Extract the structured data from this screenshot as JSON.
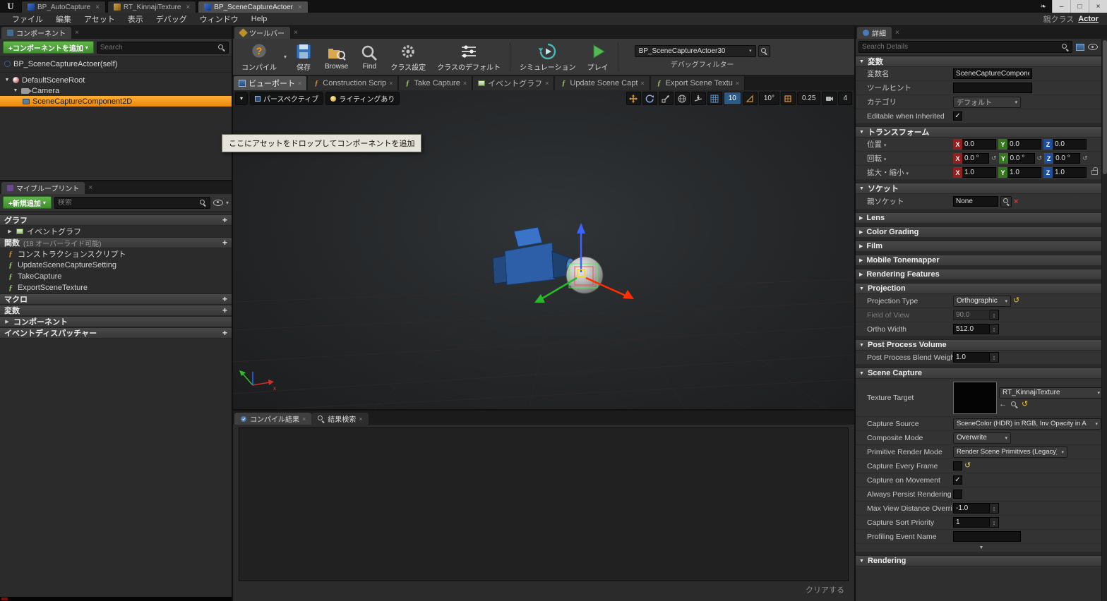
{
  "colors": {
    "selection_orange": "#E8890C",
    "add_button_green": "#3F8F2F",
    "axis_x": "#8F2121",
    "axis_y": "#35761F",
    "axis_z": "#1F4E9C",
    "reset_yellow": "#E2C23C"
  },
  "window": {
    "logo": "U",
    "tabs": [
      "BP_AutoCapture",
      "RT_KinnajiTexture",
      "BP_SceneCaptureActoer"
    ],
    "menus": [
      "ファイル",
      "編集",
      "アセット",
      "表示",
      "デバッグ",
      "ウィンドウ",
      "Help"
    ],
    "parent_class_label": "親クラス",
    "parent_class_value": "Actor",
    "minimize": "–",
    "maximize": "□",
    "close": "×"
  },
  "components": {
    "tab": "コンポーネント",
    "add_button": "+コンポーネントを追加",
    "search_placeholder": "Search",
    "items": [
      "BP_SceneCaptureActoer(self)",
      "DefaultSceneRoot",
      "Camera",
      "SceneCaptureComponent2D"
    ]
  },
  "my_blueprint": {
    "tab": "マイブループリント",
    "add_button": "+新規追加",
    "search_placeholder": "検索",
    "sections": {
      "graph": "グラフ",
      "event_graph": "イベントグラフ",
      "functions": "関数",
      "functions_note": "(18 オーバーライド可能)",
      "macro": "マクロ",
      "variables": "変数",
      "components": "コンポーネント",
      "dispatchers": "イベントディスパッチャー"
    },
    "functions": [
      "コンストラクションスクリプト",
      "UpdateSceneCaptureSetting",
      "TakeCapture",
      "ExportSceneTexture"
    ]
  },
  "toolbar": {
    "tab": "ツールバー",
    "compile": "コンパイル",
    "save": "保存",
    "browse": "Browse",
    "find": "Find",
    "class_settings": "クラス設定",
    "class_defaults": "クラスのデフォルト",
    "simulation": "シミュレーション",
    "play": "プレイ",
    "debug_object": "BP_SceneCaptureActoer30",
    "debug_filter": "デバッグフィルター"
  },
  "doc_tabs": [
    "ビューポート",
    "Construction Scrip",
    "Take Capture",
    "イベントグラフ",
    "Update Scene Capt",
    "Export Scene Textu"
  ],
  "viewport": {
    "mode": "パースペクティブ",
    "lighting": "ライティングあり",
    "grid_snap": "10",
    "angle_snap": "10°",
    "scale_snap": "0.25",
    "camera_speed": "4",
    "tooltip": "ここにアセットをドロップしてコンポーネントを追加"
  },
  "output": {
    "tab_compile": "コンパイル結果",
    "tab_search": "結果検索",
    "clear": "クリアする"
  },
  "details": {
    "tab": "詳細",
    "search_placeholder": "Search Details",
    "sections": {
      "variable": "変数",
      "transform": "トランスフォーム",
      "socket": "ソケット",
      "lens": "Lens",
      "color_grading": "Color Grading",
      "film": "Film",
      "mobile_tonemapper": "Mobile Tonemapper",
      "rendering_features": "Rendering Features",
      "projection": "Projection",
      "post_process_volume": "Post Process Volume",
      "scene_capture": "Scene Capture",
      "rendering": "Rendering"
    },
    "variable": {
      "name_label": "変数名",
      "name_value": "SceneCaptureCompone",
      "tooltip_label": "ツールヒント",
      "category_label": "カテゴリ",
      "category_value": "デフォルト",
      "editable_label": "Editable when Inherited"
    },
    "transform": {
      "location_label": "位置",
      "rotation_label": "回転",
      "scale_label": "拡大・縮小",
      "loc": {
        "x": "0.0",
        "y": "0.0",
        "z": "0.0"
      },
      "rot": {
        "x": "0.0 °",
        "y": "0.0 °",
        "z": "0.0 °"
      },
      "scl": {
        "x": "1.0",
        "y": "1.0",
        "z": "1.0"
      }
    },
    "socket": {
      "label": "親ソケット",
      "value": "None"
    },
    "projection": {
      "type_label": "Projection Type",
      "type_value": "Orthographic",
      "fov_label": "Field of View",
      "fov_value": "90.0",
      "ortho_label": "Ortho Width",
      "ortho_value": "512.0"
    },
    "ppv": {
      "label": "Post Process Blend Weigh",
      "value": "1.0"
    },
    "scene_capture": {
      "texture_target_label": "Texture Target",
      "texture_target_value": "RT_KinnajiTexture",
      "capture_source_label": "Capture Source",
      "capture_source_value": "SceneColor (HDR) in RGB, Inv Opacity in A",
      "composite_label": "Composite Mode",
      "composite_value": "Overwrite",
      "primitive_label": "Primitive Render Mode",
      "primitive_value": "Render Scene Primitives (Legacy)",
      "every_frame_label": "Capture Every Frame",
      "on_movement_label": "Capture on Movement",
      "persist_label": "Always Persist Rendering",
      "max_dist_label": "Max View Distance Overri",
      "max_dist_value": "-1.0",
      "sort_label": "Capture Sort Priority",
      "sort_value": "1",
      "profiling_label": "Profiling Event Name"
    }
  }
}
